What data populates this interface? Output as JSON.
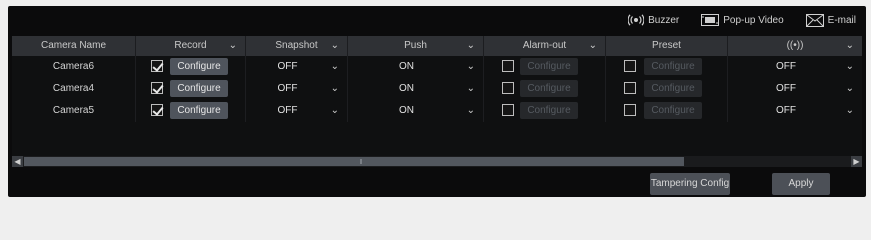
{
  "toolbar": {
    "buzzer_label": "Buzzer",
    "popup_label": "Pop-up Video",
    "email_label": "E-mail"
  },
  "columns": {
    "camera_name": "Camera Name",
    "record": "Record",
    "snapshot": "Snapshot",
    "push": "Push",
    "alarm_out": "Alarm-out",
    "preset": "Preset",
    "buzzer_icon": "((•))"
  },
  "rows": [
    {
      "name": "Camera6",
      "record_checked": true,
      "configure": "Configure",
      "snapshot": "OFF",
      "push": "ON",
      "alarm_out_checked": false,
      "alarm_configure": "Configure",
      "preset_checked": false,
      "preset_configure": "Configure",
      "buzzer": "OFF"
    },
    {
      "name": "Camera4",
      "record_checked": true,
      "configure": "Configure",
      "snapshot": "OFF",
      "push": "ON",
      "alarm_out_checked": false,
      "alarm_configure": "Configure",
      "preset_checked": false,
      "preset_configure": "Configure",
      "buzzer": "OFF"
    },
    {
      "name": "Camera5",
      "record_checked": true,
      "configure": "Configure",
      "snapshot": "OFF",
      "push": "ON",
      "alarm_out_checked": false,
      "alarm_configure": "Configure",
      "preset_checked": false,
      "preset_configure": "Configure",
      "buzzer": "OFF"
    }
  ],
  "footer": {
    "tampering_label": "Tampering Config",
    "apply_label": "Apply"
  },
  "icons": {
    "dropdown": "chevron-down-icon",
    "buzzer": "buzzer-icon",
    "popup": "popup-video-icon",
    "email": "email-icon"
  },
  "colors": {
    "background": "#0b0b0c",
    "header": "#2f3135",
    "button": "#4c5057"
  }
}
